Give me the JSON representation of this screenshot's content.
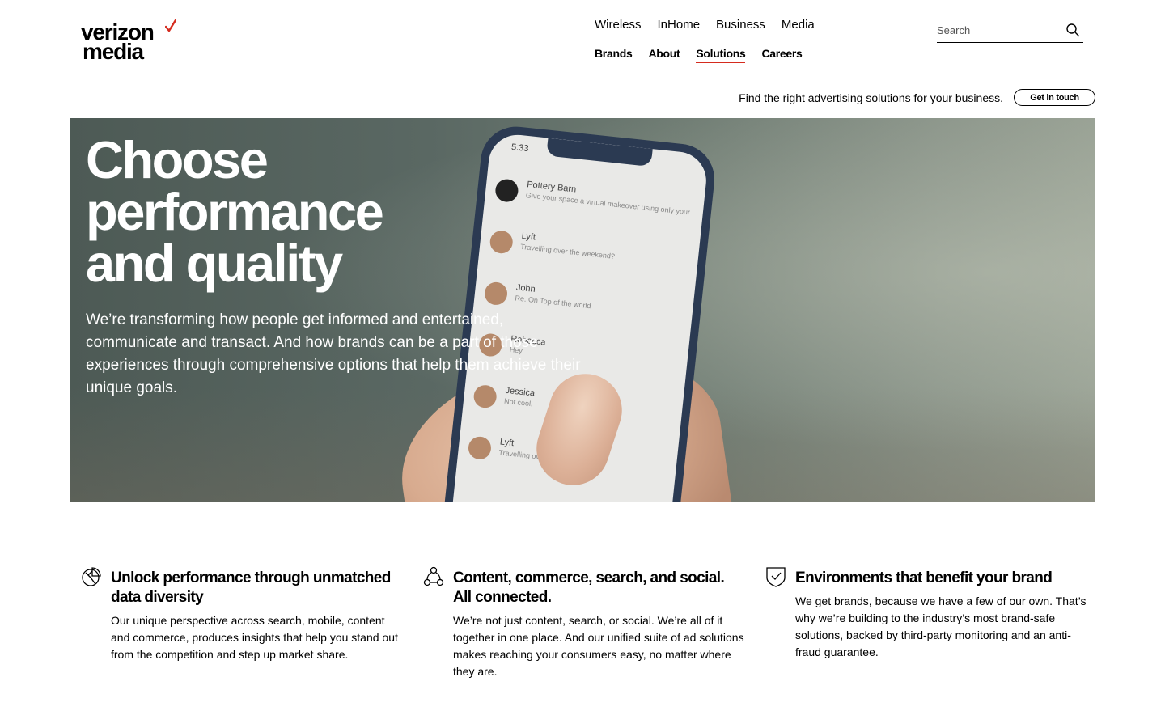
{
  "brand": {
    "line1": "verizon",
    "line2": "media",
    "accent": "#d52b1e"
  },
  "nav": {
    "primary": [
      "Wireless",
      "InHome",
      "Business",
      "Media"
    ],
    "secondary": [
      "Brands",
      "About",
      "Solutions",
      "Careers"
    ],
    "active": "Solutions"
  },
  "search": {
    "placeholder": "Search",
    "icon": "search-icon"
  },
  "promo": {
    "text": "Find the right advertising solutions for your business.",
    "button": "Get in touch"
  },
  "hero": {
    "heading_line1": "Choose",
    "heading_line2": "performance",
    "heading_line3": "and quality",
    "body": "We’re transforming how people get informed and entertained, communicate and transact. And how brands can be a part of those experiences through comprehensive options that help them achieve their unique goals."
  },
  "phone": {
    "time": "5:33",
    "messages": [
      {
        "name": "Pottery Barn",
        "text": "Give your space a virtual makeover using only your"
      },
      {
        "name": "Lyft",
        "text": "Travelling over the weekend?"
      },
      {
        "name": "John",
        "text": "Re: On Top of the world"
      },
      {
        "name": "Rebecca",
        "text": "Hey"
      },
      {
        "name": "Jessica",
        "text": "Not cool!"
      },
      {
        "name": "Lyft",
        "text": "Travelling over the weekend?"
      }
    ]
  },
  "features": [
    {
      "icon": "pie-chart-icon",
      "title": "Unlock performance through unmatched data diversity",
      "body": "Our unique perspective across search, mobile, content and commerce, produces insights that help you stand out from the competition and step up market share."
    },
    {
      "icon": "network-icon",
      "title": "Content, commerce, search, and social. All connected.",
      "body": "We’re not just content, search, or social. We’re all of it together in one place. And our unified suite of ad solutions makes reaching your consumers easy, no matter where they are."
    },
    {
      "icon": "shield-check-icon",
      "title": "Environments that benefit your brand",
      "body": "We get brands, because we have a few of our own. That’s why we’re building to the industry’s most brand-safe solutions, backed by third-party monitoring and an anti-fraud guarantee."
    }
  ]
}
